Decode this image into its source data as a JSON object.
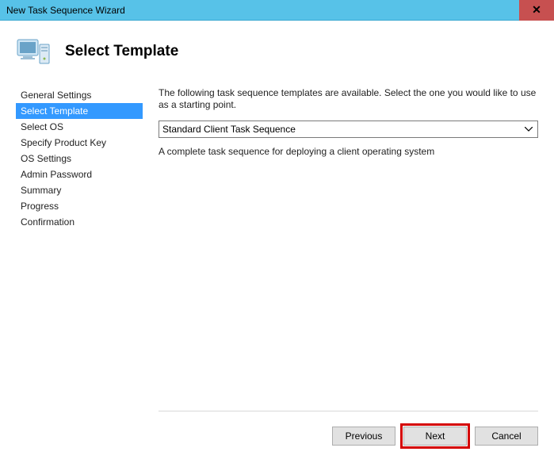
{
  "window": {
    "title": "New Task Sequence Wizard",
    "close_glyph": "✕"
  },
  "header": {
    "title": "Select Template"
  },
  "sidebar": {
    "items": [
      {
        "label": "General Settings",
        "active": false
      },
      {
        "label": "Select Template",
        "active": true
      },
      {
        "label": "Select OS",
        "active": false
      },
      {
        "label": "Specify Product Key",
        "active": false
      },
      {
        "label": "OS Settings",
        "active": false
      },
      {
        "label": "Admin Password",
        "active": false
      },
      {
        "label": "Summary",
        "active": false
      },
      {
        "label": "Progress",
        "active": false
      },
      {
        "label": "Confirmation",
        "active": false
      }
    ]
  },
  "main": {
    "instruction": "The following task sequence templates are available.  Select the one you would like to use as a starting point.",
    "selected_template": "Standard Client Task Sequence",
    "description": "A complete task sequence for deploying a client operating system"
  },
  "footer": {
    "previous": "Previous",
    "next": "Next",
    "cancel": "Cancel"
  }
}
